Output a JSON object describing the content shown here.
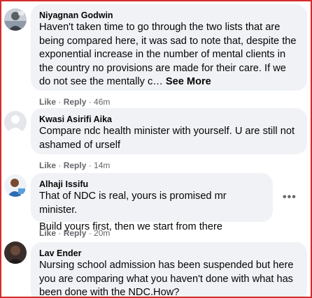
{
  "comments": [
    {
      "author": "Niyagnan Godwin",
      "lines": [
        "Haven't taken time to go through the two lists that are",
        "being compared here, it was sad to note that, despite the",
        "exponential increase in the number of mental clients in",
        "the country no provisions are made for their care. If we",
        "do not see the mentally c…"
      ],
      "see_more": "See More",
      "like": "Like",
      "reply": "Reply",
      "time": "46m"
    },
    {
      "author": "Kwasi Asirifi Aika",
      "lines": [
        "Compare ndc health minister with yourself. U are still not",
        "ashamed of urself"
      ],
      "like": "Like",
      "reply": "Reply",
      "time": "14m"
    },
    {
      "author": "Alhaji Issifu",
      "lines": [
        "That of NDC is real, yours is promised mr minister.",
        "Build yours first, then we start from there"
      ],
      "more_icon": "more-horizontal-icon",
      "like": "Like",
      "reply": "Reply",
      "time": "20m"
    },
    {
      "author": "Lav Ender",
      "lines": [
        "Nursing school admission has been suspended but here",
        "you are comparing what you haven't done with what has",
        "been done with the NDC.How?"
      ]
    }
  ],
  "separator": " · ",
  "colors": {
    "border": "#d42b2b",
    "bubble": "#f0f2f5",
    "text": "#050505",
    "meta": "#65676b"
  }
}
